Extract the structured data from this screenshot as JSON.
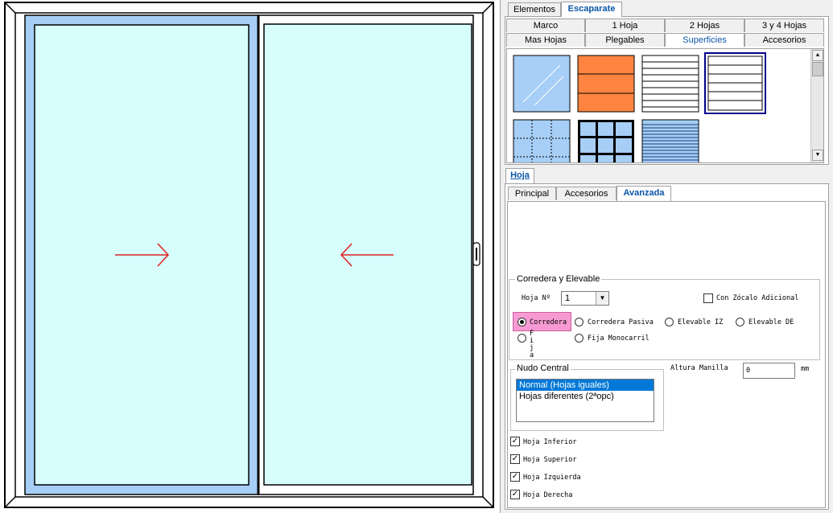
{
  "top_tabs": [
    "Elementos",
    "Escaparate"
  ],
  "sub_tabs_row1": [
    "Marco",
    "1 Hoja",
    "2 Hojas",
    "3 y 4 Hojas"
  ],
  "sub_tabs_row2": [
    "Mas Hojas",
    "Plegables",
    "Superficies",
    "Accesorios"
  ],
  "hoja_tab": "Hoja",
  "hoja_sub_tabs": [
    "Principal",
    "Accesorios",
    "Avanzada"
  ],
  "corredera": {
    "group_title": "Corredera y Elevable",
    "hoja_label": "Hoja Nº",
    "hoja_value": "1",
    "zocalo_label": "Con Zócalo Adicional",
    "options": [
      "Corredera",
      "Corredera Pasiva",
      "Elevable IZ",
      "Elevable DE",
      "Fija",
      "Fija Monocarril"
    ]
  },
  "nudo": {
    "group_title": "Nudo Central",
    "items": [
      "Normal (Hojas iguales)",
      "Hojas diferentes (2ªopc)"
    ]
  },
  "altura": {
    "label": "Altura Manilla",
    "value": "0",
    "unit": "mm"
  },
  "checks": [
    "Hoja Inferior",
    "Hoja Superior",
    "Hoja Izquierda",
    "Hoja Derecha"
  ],
  "colors": {
    "glass": "#d7fdfd",
    "selected_sash": "#a6cef6",
    "arrow": "#e02020",
    "accent": "#0a55a8",
    "pink": "#f79ad3",
    "orange": "#fe8440"
  }
}
